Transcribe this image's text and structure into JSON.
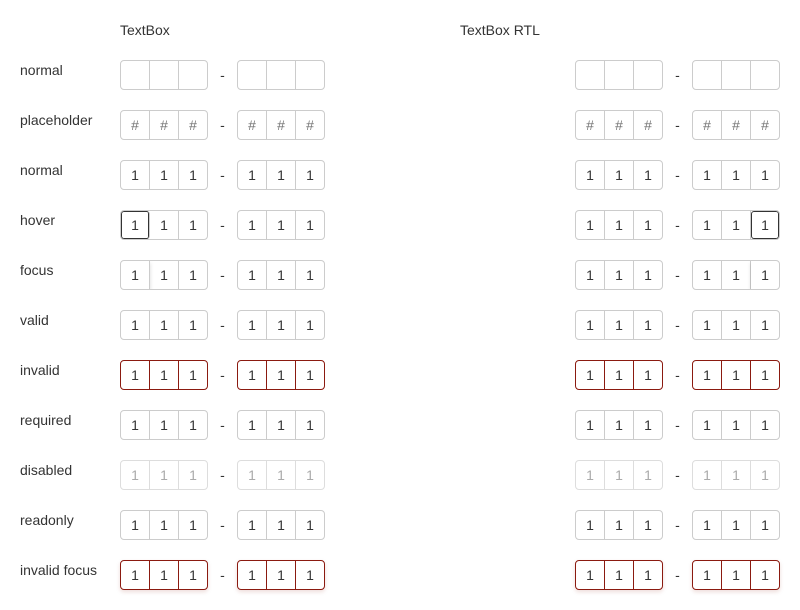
{
  "columns": {
    "ltr_title": "TextBox",
    "rtl_title": "TextBox RTL"
  },
  "separator": "-",
  "rows": [
    {
      "label": "normal",
      "state": "empty",
      "values": [
        "",
        "",
        ""
      ]
    },
    {
      "label": "placeholder",
      "state": "placeholder",
      "values": [
        "#",
        "#",
        "#"
      ]
    },
    {
      "label": "normal",
      "state": "normal",
      "values": [
        "1",
        "1",
        "1"
      ]
    },
    {
      "label": "hover",
      "state": "hover",
      "values": [
        "1",
        "1",
        "1"
      ]
    },
    {
      "label": "focus",
      "state": "focus",
      "values": [
        "1",
        "1",
        "1"
      ]
    },
    {
      "label": "valid",
      "state": "valid",
      "values": [
        "1",
        "1",
        "1"
      ]
    },
    {
      "label": "invalid",
      "state": "invalid",
      "values": [
        "1",
        "1",
        "1"
      ]
    },
    {
      "label": "required",
      "state": "required",
      "values": [
        "1",
        "1",
        "1"
      ]
    },
    {
      "label": "disabled",
      "state": "disabled",
      "values": [
        "1",
        "1",
        "1"
      ]
    },
    {
      "label": "readonly",
      "state": "readonly",
      "values": [
        "1",
        "1",
        "1"
      ]
    },
    {
      "label": "invalid focus",
      "state": "invalid-focus",
      "values": [
        "1",
        "1",
        "1"
      ]
    }
  ],
  "colors": {
    "border": "#cccccc",
    "border_hover": "#333333",
    "border_invalid": "#8b1a10",
    "text_disabled": "#aaaaaa",
    "text_placeholder": "#757575"
  }
}
